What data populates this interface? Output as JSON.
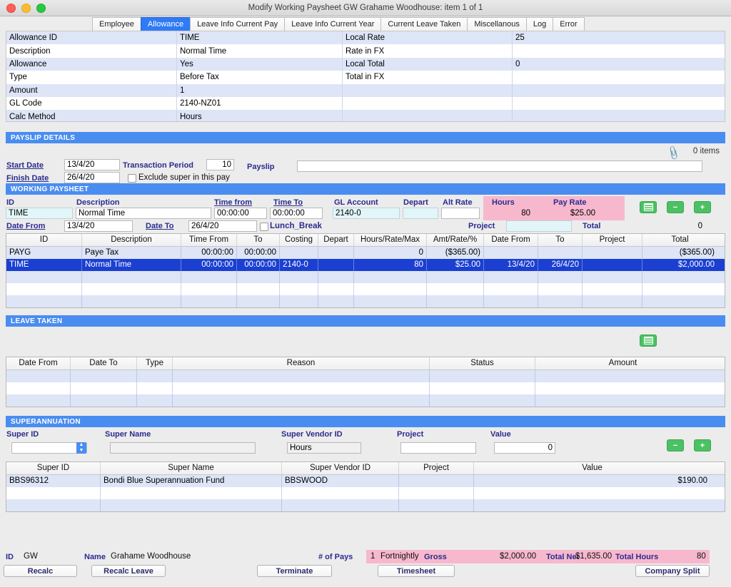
{
  "window": {
    "title": "Modify Working Paysheet GW Grahame Woodhouse: item 1  of  1"
  },
  "tabs": [
    {
      "label": "Employee",
      "active": false
    },
    {
      "label": "Allowance",
      "active": true
    },
    {
      "label": "Leave Info Current Pay",
      "active": false
    },
    {
      "label": "Leave Info Current Year",
      "active": false
    },
    {
      "label": "Current Leave Taken",
      "active": false
    },
    {
      "label": "Miscellanous",
      "active": false
    },
    {
      "label": "Log",
      "active": false
    },
    {
      "label": "Error",
      "active": false
    }
  ],
  "allowance_detail": {
    "rows": [
      {
        "label": "Allowance ID",
        "value": "TIME",
        "label2": "Local Rate",
        "value2": "25"
      },
      {
        "label": "Description",
        "value": "Normal Time",
        "label2": "Rate in FX",
        "value2": ""
      },
      {
        "label": "Allowance",
        "value": "Yes",
        "label2": "Local Total",
        "value2": "0"
      },
      {
        "label": "Type",
        "value": "Before Tax",
        "label2": "Total in FX",
        "value2": ""
      },
      {
        "label": "Amount",
        "value": "1",
        "label2": "",
        "value2": ""
      },
      {
        "label": "GL Code",
        "value": "2140-NZ01",
        "label2": "",
        "value2": ""
      },
      {
        "label": "Calc Method",
        "value": "Hours",
        "label2": "",
        "value2": ""
      }
    ]
  },
  "payslip_details": {
    "section_title": "PAYSLIP DETAILS",
    "start_date_label": "Start Date",
    "start_date_value": "13/4/20",
    "finish_date_label": "Finish Date",
    "finish_date_value": "26/4/20",
    "transaction_period_label": "Transaction Period",
    "transaction_period_value": "10",
    "payslip_label": "Payslip",
    "payslip_value": "",
    "exclude_super_label": "Exclude super in this pay",
    "attachment_items": "0 items"
  },
  "working_paysheet": {
    "section_title": "WORKING PAYSHEET",
    "labels": {
      "id": "ID",
      "description": "Description",
      "time_from": "Time from",
      "time_to": "Time To",
      "gl_account": "GL Account",
      "depart": "Depart",
      "alt_rate": "Alt Rate",
      "hours": "Hours",
      "pay_rate": "Pay Rate",
      "date_from": "Date From",
      "date_to": "Date To",
      "lunch_break": "Lunch_Break",
      "project": "Project",
      "total": "Total"
    },
    "values": {
      "id": "TIME",
      "description": "Normal Time",
      "time_from": "00:00:00",
      "time_to": "00:00:00",
      "gl_account": "2140-0",
      "depart": "",
      "alt_rate": "",
      "hours": "80",
      "pay_rate": "$25.00",
      "date_from": "13/4/20",
      "date_to": "26/4/20",
      "project": "",
      "total": "0"
    },
    "table": {
      "headers": [
        "ID",
        "Description",
        "Time From",
        "To",
        "Costing",
        "Depart",
        "Hours/Rate/Max",
        "Amt/Rate/%",
        "Date From",
        "To",
        "Project",
        "Total"
      ],
      "rows": [
        {
          "selected": false,
          "cells": [
            "PAYG",
            "Paye Tax",
            "00:00:00",
            "00:00:00",
            "",
            "",
            "0",
            "($365.00)",
            "",
            "",
            "",
            "($365.00)"
          ]
        },
        {
          "selected": true,
          "cells": [
            "TIME",
            "Normal Time",
            "00:00:00",
            "00:00:00",
            "2140-0",
            "",
            "80",
            "$25.00",
            "13/4/20",
            "26/4/20",
            "",
            "$2,000.00"
          ]
        },
        {
          "selected": false,
          "cells": [
            "",
            "",
            "",
            "",
            "",
            "",
            "",
            "",
            "",
            "",
            "",
            ""
          ]
        },
        {
          "selected": false,
          "cells": [
            "",
            "",
            "",
            "",
            "",
            "",
            "",
            "",
            "",
            "",
            "",
            ""
          ]
        },
        {
          "selected": false,
          "cells": [
            "",
            "",
            "",
            "",
            "",
            "",
            "",
            "",
            "",
            "",
            "",
            ""
          ]
        }
      ]
    },
    "buttons": {
      "list": "list-icon",
      "minus": "−",
      "plus": "+"
    }
  },
  "leave_taken": {
    "section_title": "LEAVE TAKEN",
    "headers": [
      "Date From",
      "Date To",
      "Type",
      "Reason",
      "Status",
      "Amount"
    ],
    "rows": [
      {
        "cells": [
          "",
          "",
          "",
          "",
          "",
          ""
        ]
      },
      {
        "cells": [
          "",
          "",
          "",
          "",
          "",
          ""
        ]
      },
      {
        "cells": [
          "",
          "",
          "",
          "",
          "",
          ""
        ]
      }
    ],
    "list_button": "list-icon"
  },
  "superannuation": {
    "section_title": "SUPERANNUATION",
    "labels": {
      "super_id": "Super ID",
      "super_name": "Super Name",
      "super_vendor_id": "Super Vendor ID",
      "project": "Project",
      "value": "Value"
    },
    "values": {
      "super_id": "",
      "super_name": "",
      "super_vendor_id": "Hours",
      "project": "",
      "value": "0"
    },
    "headers": [
      "Super ID",
      "Super Name",
      "Super Vendor ID",
      "Project",
      "Value"
    ],
    "rows": [
      {
        "cells": [
          "BBS96312",
          "Bondi Blue Superannuation Fund",
          "BBSWOOD",
          "",
          "$190.00"
        ]
      },
      {
        "cells": [
          "",
          "",
          "",
          "",
          ""
        ]
      },
      {
        "cells": [
          "",
          "",
          "",
          "",
          ""
        ]
      }
    ],
    "buttons": {
      "minus": "−",
      "plus": "+"
    }
  },
  "footer": {
    "id_label": "ID",
    "id_value": "GW",
    "name_label": "Name",
    "name_value": "Grahame Woodhouse",
    "num_pays_label": "# of Pays",
    "num_pays_value": "1",
    "frequency_value": "Fortnightly",
    "gross_label": "Gross",
    "gross_value": "$2,000.00",
    "total_net_label": "Total Net",
    "total_net_value": "$1,635.00",
    "total_hours_label": "Total Hours",
    "total_hours_value": "80",
    "buttons": {
      "recalc": "Recalc",
      "recalc_leave": "Recalc Leave",
      "terminate": "Terminate",
      "timesheet": "Timesheet",
      "company_split": "Company Split"
    }
  },
  "colors": {
    "section_blue": "#4a8df0",
    "selection_blue": "#1a3fd1",
    "pink": "#f7b8cd",
    "green": "#4cc163",
    "label_navy": "#2b2b8f"
  }
}
